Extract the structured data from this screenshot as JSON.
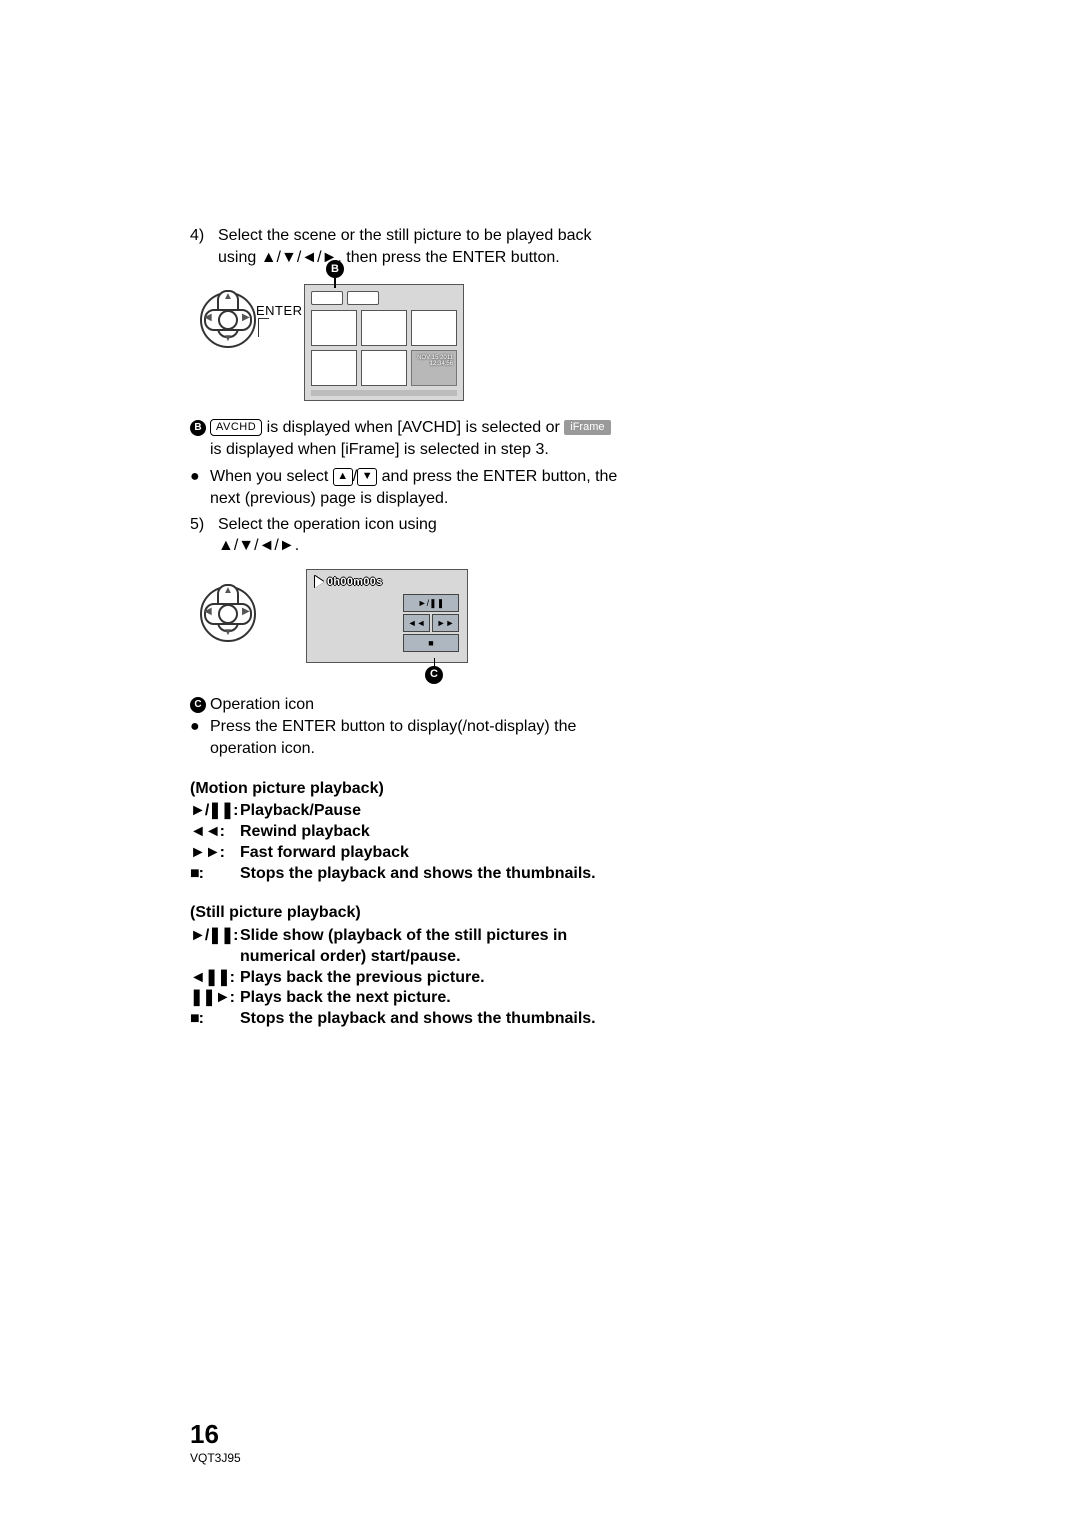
{
  "step4": {
    "num": "4)",
    "text_1": "Select the scene or the still picture to be played back using ",
    "text_arrows": "▲/▼/◄/►",
    "text_2": ", then press the ENTER button."
  },
  "enter_label": "ENTER",
  "calloutB": "B",
  "calloutC": "C",
  "thumbnail_date": {
    "line1": "NOV 15 2011",
    "line2": "12:34:56"
  },
  "badge_avchd": "AVCHD",
  "badge_iframe": "iFrame",
  "explainB": {
    "part1": " is displayed when [AVCHD] is selected or ",
    "part2": " is displayed when [iFrame] is selected in step 3."
  },
  "bullet_when": {
    "pre": "When you select ",
    "slash": "/",
    "post": " and press the ENTER button, the next (previous) page is displayed."
  },
  "key_up": "▲",
  "key_down": "▼",
  "step5": {
    "num": "5)",
    "text_1": "Select the operation icon using ",
    "text_arrows": "▲/▼/◄/►",
    "text_2": "."
  },
  "timecode": "0h00m00s",
  "op_icon_label": "Operation icon",
  "bullet_press": "Press the ENTER button to display(/not-display) the operation icon.",
  "motion": {
    "header": "(Motion picture playback)",
    "rows": [
      {
        "sym": "►/❚❚:",
        "desc": "Playback/Pause"
      },
      {
        "sym": "◄◄:",
        "desc": "Rewind playback"
      },
      {
        "sym": "►►:",
        "desc": "Fast forward playback"
      },
      {
        "sym": "■:",
        "desc": "Stops the playback and shows the thumbnails."
      }
    ]
  },
  "still": {
    "header": "(Still picture playback)",
    "rows": [
      {
        "sym": "►/❚❚:",
        "desc": "Slide show (playback of the still pictures in numerical order) start/pause."
      },
      {
        "sym": "◄❚❚:",
        "desc": "Plays back the previous picture."
      },
      {
        "sym": "❚❚►:",
        "desc": "Plays back the next picture."
      },
      {
        "sym": "■:",
        "desc": "Stops the playback and shows the thumbnails."
      }
    ]
  },
  "page_number": "16",
  "doc_code": "VQT3J95",
  "chart_data": null
}
